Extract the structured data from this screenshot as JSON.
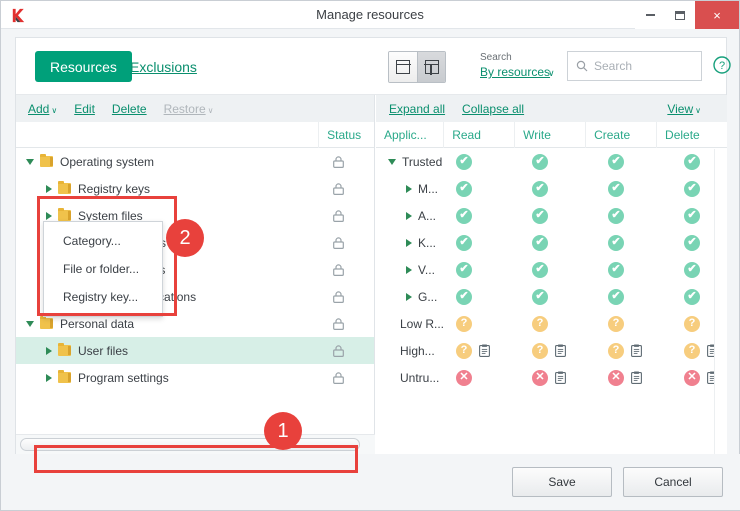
{
  "window": {
    "title": "Manage resources",
    "logo_icon": "kaspersky-k-logo",
    "minimize_label": "–",
    "maximize_label": "□",
    "close_label": "×"
  },
  "topbar": {
    "tab_resources": "Resources",
    "tab_exclusions": "Exclusions",
    "view_single_icon": "single-pane-icon",
    "view_split_icon": "split-pane-icon",
    "search_label": "Search",
    "search_by": "By resources",
    "search_chevron": "∨",
    "search_placeholder": "Search",
    "search_value": "",
    "search_icon": "search-icon",
    "help_icon": "help-circle-icon"
  },
  "left_pane": {
    "toolbar": {
      "add": "Add",
      "add_chevron": "∨",
      "edit": "Edit",
      "delete": "Delete",
      "restore": "Restore",
      "restore_chevron": "∨"
    },
    "columns": [
      "",
      "Status"
    ],
    "status_icon": "lock-icon",
    "rows": [
      {
        "label": "Operating system",
        "indent": 0,
        "expanded": true,
        "arrow": "open",
        "hidden_by_menu": true,
        "status": "lock-icon"
      },
      {
        "label": "Registry keys",
        "indent": 1,
        "arrow": "closed",
        "hidden_by_menu": true,
        "status": "lock-icon"
      },
      {
        "label": "System files",
        "indent": 1,
        "arrow": "closed",
        "partially_hidden": true,
        "status": "lock-icon"
      },
      {
        "label": "Security settings",
        "indent": 1,
        "arrow": "closed",
        "status": "lock-icon"
      },
      {
        "label": "System services",
        "indent": 1,
        "arrow": "closed",
        "status": "lock-icon"
      },
      {
        "label": "Protected applications",
        "indent": 1,
        "arrow": "closed",
        "status": "lock-icon"
      },
      {
        "label": "Personal data",
        "indent": 0,
        "arrow": "open",
        "status": "lock-icon"
      },
      {
        "label": "User files",
        "indent": 1,
        "arrow": "closed",
        "selected": true,
        "status": "lock-icon"
      },
      {
        "label": "Program settings",
        "indent": 1,
        "arrow": "closed",
        "status": "lock-icon"
      }
    ],
    "add_menu": {
      "items": [
        "Category...",
        "File or folder...",
        "Registry key..."
      ]
    }
  },
  "right_pane": {
    "toolbar": {
      "expand_all": "Expand all",
      "collapse_all": "Collapse all",
      "view": "View",
      "view_chevron": "∨"
    },
    "columns": [
      "Applic...",
      "Read",
      "Write",
      "Create",
      "Delete"
    ],
    "rows": [
      {
        "label": "Trusted",
        "indent": 0,
        "arrow": "open",
        "perms": [
          "ok",
          "ok",
          "ok",
          "ok"
        ],
        "clips": [
          false,
          false,
          false,
          false
        ]
      },
      {
        "label": "M...",
        "indent": 1,
        "arrow": "closed",
        "perms": [
          "ok",
          "ok",
          "ok",
          "ok"
        ],
        "clips": [
          false,
          false,
          false,
          false
        ]
      },
      {
        "label": "A...",
        "indent": 1,
        "arrow": "closed",
        "perms": [
          "ok",
          "ok",
          "ok",
          "ok"
        ],
        "clips": [
          false,
          false,
          false,
          false
        ]
      },
      {
        "label": "K...",
        "indent": 1,
        "arrow": "closed",
        "perms": [
          "ok",
          "ok",
          "ok",
          "ok"
        ],
        "clips": [
          false,
          false,
          false,
          false
        ]
      },
      {
        "label": "V...",
        "indent": 1,
        "arrow": "closed",
        "perms": [
          "ok",
          "ok",
          "ok",
          "ok"
        ],
        "clips": [
          false,
          false,
          false,
          false
        ]
      },
      {
        "label": "G...",
        "indent": 1,
        "arrow": "closed",
        "perms": [
          "ok",
          "ok",
          "ok",
          "ok"
        ],
        "clips": [
          false,
          false,
          false,
          false
        ]
      },
      {
        "label": "Low R...",
        "indent": 0,
        "arrow": "none",
        "perms": [
          "ask",
          "ask",
          "ask",
          "ask"
        ],
        "clips": [
          false,
          false,
          false,
          false
        ]
      },
      {
        "label": "High...",
        "indent": 0,
        "arrow": "none",
        "perms": [
          "ask",
          "ask",
          "ask",
          "ask"
        ],
        "clips": [
          true,
          true,
          true,
          true
        ]
      },
      {
        "label": "Untru...",
        "indent": 0,
        "arrow": "none",
        "perms": [
          "no",
          "no",
          "no",
          "no"
        ],
        "clips": [
          false,
          true,
          true,
          true
        ]
      }
    ],
    "badge_glyphs": {
      "ok": "✔",
      "ask": "?",
      "no": "✕"
    },
    "clip_icon": "clipboard-icon"
  },
  "callouts": [
    {
      "number": "1",
      "target": "user-files-row"
    },
    {
      "number": "2",
      "target": "add-menu"
    }
  ],
  "footer": {
    "save": "Save",
    "cancel": "Cancel"
  },
  "colors": {
    "accent_green": "#00a07a",
    "link_green": "#0a8f6e",
    "header_teal": "#2aa98a",
    "callout_red": "#e8413c",
    "ok": "#79d4b4",
    "ask": "#f7cd7e",
    "no": "#f0808f",
    "selection": "#d7efe7",
    "folder_yellow": "#f0c24b"
  }
}
